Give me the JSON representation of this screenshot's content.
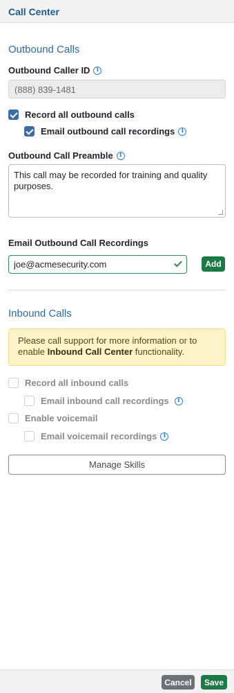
{
  "header": {
    "title": "Call Center"
  },
  "outbound": {
    "section_title": "Outbound Calls",
    "caller_id_label": "Outbound Caller ID",
    "caller_id_value": "(888) 839-1481",
    "record_all_label": "Record all outbound calls",
    "record_all_checked": true,
    "email_recordings_label": "Email outbound call recordings",
    "email_recordings_checked": true,
    "preamble_label": "Outbound Call Preamble",
    "preamble_value": "This call may be recorded for training and quality purposes.",
    "email_recordings_section_label": "Email Outbound Call Recordings",
    "email_value": "joe@acmesecurity.com",
    "add_label": "Add"
  },
  "inbound": {
    "section_title": "Inbound Calls",
    "alert_text_before": "Please call support for more information or to enable ",
    "alert_text_bold": "Inbound Call Center",
    "alert_text_after": " functionality.",
    "record_all_label": "Record all inbound calls",
    "email_recordings_label": "Email inbound call recordings",
    "voicemail_label": "Enable voicemail",
    "email_voicemail_label": "Email voicemail recordings",
    "manage_skills_label": "Manage Skills"
  },
  "footer": {
    "cancel_label": "Cancel",
    "save_label": "Save"
  },
  "icons": {
    "info": "info-icon",
    "check": "checkmark-icon"
  },
  "colors": {
    "accent": "#2a6aa8",
    "success": "#1e7a45",
    "checkbox": "#3c6ea5",
    "alert_bg": "#fdf3c9"
  }
}
